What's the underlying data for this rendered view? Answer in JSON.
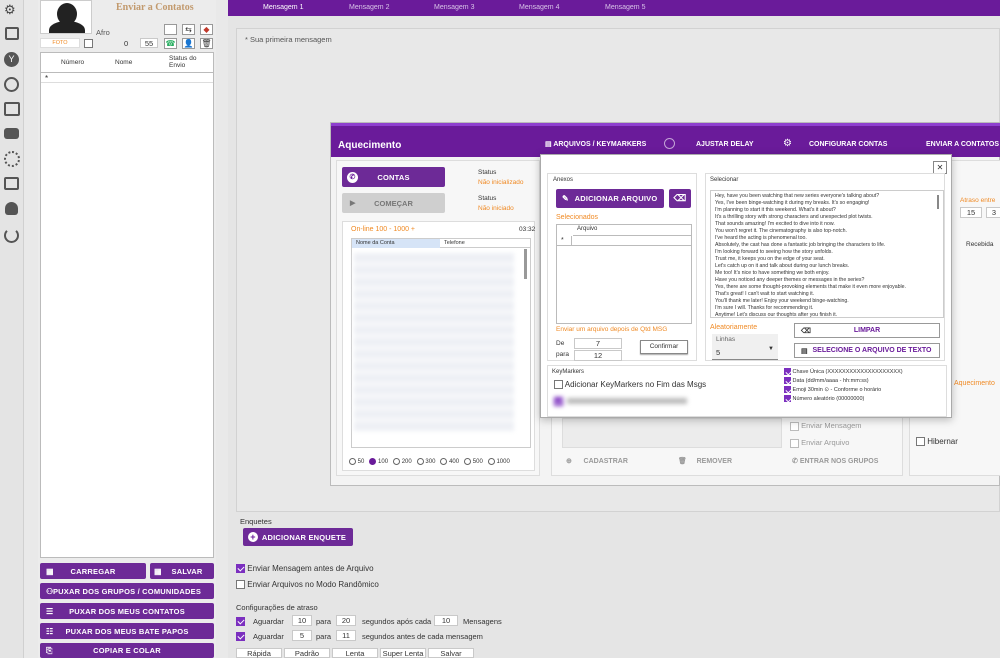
{
  "left_panel": {
    "title": "Enviar a Contatos",
    "name": "Afro",
    "foto_label": "FOTO",
    "count_zero": "0",
    "count_55": "55",
    "table_headers": [
      "Número",
      "Nome",
      "Status do Envio"
    ],
    "row_marker": "*",
    "buttons": {
      "carregar": "CARREGAR",
      "salvar": "SALVAR",
      "puxar_grupos": "PUXAR DOS GRUPOS / COMUNIDADES",
      "puxar_contatos": "PUXAR DOS MEUS CONTATOS",
      "puxar_bate_papos": "PUXAR DOS MEUS BATE PAPOS",
      "copiar_colar": "COPIAR E COLAR"
    }
  },
  "message_tabs": [
    "Mensagem 1",
    "Mensagem 2",
    "Mensagem 3",
    "Mensagem 4",
    "Mensagem 5"
  ],
  "message_placeholder": "* Sua primeira mensagem",
  "enquetes": {
    "label": "Enquetes",
    "button": "ADICIONAR ENQUETE"
  },
  "options": {
    "enviar_antes": "Enviar Mensagem antes de Arquivo",
    "modo_randomico": "Enviar Arquivos no Modo Randômico"
  },
  "delay": {
    "label": "Configurações de atraso",
    "row1": {
      "aguardar": "Aguardar",
      "from": "10",
      "para": "para",
      "to": "20",
      "suffix": "segundos após cada",
      "count": "10",
      "unit": "Mensagens"
    },
    "row2": {
      "aguardar": "Aguardar",
      "from": "5",
      "para": "para",
      "to": "11",
      "suffix": "segundos antes de cada mensagem"
    },
    "presets": [
      "Rápida",
      "Padrão",
      "Lenta",
      "Super Lenta",
      "Salvar"
    ]
  },
  "aquecimento": {
    "title": "Aquecimento",
    "nav": [
      "ARQUIVOS / KEYMARKERS",
      "AJUSTAR DELAY",
      "CONFIGURAR CONTAS",
      "ENVIAR A CONTATOS"
    ],
    "contas_button": "CONTAS",
    "comecar_button": "COMEÇAR",
    "status1_label": "Status",
    "status1_value": "Não inicializado",
    "status2_label": "Status",
    "status2_value": "Não iniciado",
    "online_label": "On-line 100 - 1000 +",
    "time": "03:32",
    "list_headers": [
      "Nome da Conta",
      "Telefone"
    ],
    "radio_options": [
      "50",
      "100",
      "200",
      "300",
      "400",
      "500",
      "1000"
    ],
    "bottom": {
      "cadastrar": "CADASTRAR",
      "remover": "REMOVER",
      "entrar_grupos": "ENTRAR NOS GRUPOS",
      "enviar_mensagem": "Enviar Mensagem",
      "enviar_arquivo": "Enviar Arquivo",
      "hibernar": "Hibernar"
    },
    "right": {
      "atraso_label": "Atraso entre",
      "atraso_from": "15",
      "atraso_to": "3",
      "recebida": "Recebida",
      "aquecimento_label": "Aquecimento"
    }
  },
  "arquivos_dialog": {
    "anexos_label": "Anexos",
    "adicionar_arquivo": "ADICIONAR ARQUIVO",
    "selecionados_label": "Selecionados",
    "arquivo_col": "Arquivo",
    "row_marker": "*",
    "enviar_depois_label": "Enviar um arquivo depois de Qtd MSG",
    "de_label": "De",
    "de_value": "7",
    "para_label": "para",
    "para_value": "12",
    "confirmar": "Confirmar",
    "selecionar_label": "Selecionar",
    "text_lines": [
      "Hey, have you been watching that new series everyone's talking about?",
      "Yes, I've been binge-watching it during my breaks. It's so engaging!",
      "I'm planning to start it this weekend. What's it about?",
      "It's a thrilling story with strong characters and unexpected plot twists.",
      "That sounds amazing! I'm excited to dive into it now.",
      "You won't regret it. The cinematography is also top-notch.",
      "I've heard the acting is phenomenal too.",
      "Absolutely, the cast has done a fantastic job bringing the characters to life.",
      "I'm looking forward to seeing how the story unfolds.",
      "Trust me, it keeps you on the edge of your seat.",
      "Let's catch up on it and talk about during our lunch breaks.",
      "Me too! It's nice to have something we both enjoy.",
      "Have you noticed any deeper themes or messages in the series?",
      "Yes, there are some thought-provoking elements that make it even more enjoyable.",
      "That's great! I can't wait to start watching it.",
      "You'll thank me later! Enjoy your weekend binge-watching.",
      "I'm sure I will. Thanks for recommending it.",
      "Anytime! Let's discuss our thoughts after you finish it."
    ],
    "aleatoriamente_label": "Aleatoriamente",
    "linhas_label": "Linhas",
    "linhas_value": "5",
    "limpar": "LIMPAR",
    "selecione_texto": "SELECIONE O ARQUIVO DE TEXTO",
    "keymarkers_label": "KeyMarkers",
    "add_keymarkers": "Adicionar KeyMarkers no Fim das Msgs",
    "keymarkers": [
      "Chave Única (XXXXXXXXXXXXXXXXXXXX)",
      "Data (dd/mm/aaaa - hh:mm:ss)",
      "Emoji 30min ⊙ - Conforme o horário",
      "Número aleatório (00000000)"
    ],
    "close": "✕"
  },
  "colors": {
    "accent": "#6a1b9a",
    "orange": "#f08a24"
  }
}
